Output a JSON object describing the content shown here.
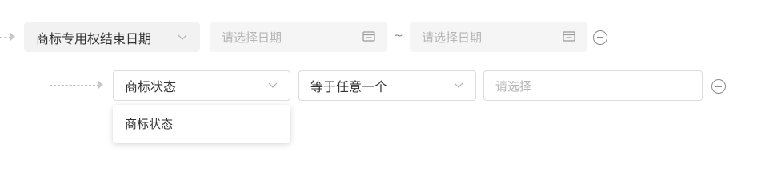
{
  "row1": {
    "field_select": {
      "value": "商标专用权结束日期"
    },
    "date_start": {
      "placeholder": "请选择日期"
    },
    "range_separator": "~",
    "date_end": {
      "placeholder": "请选择日期"
    }
  },
  "row2": {
    "field_select": {
      "value": "商标状态"
    },
    "operator_select": {
      "value": "等于任意一个"
    },
    "value_input": {
      "placeholder": "请选择"
    }
  },
  "dropdown": {
    "options": [
      "商标状态"
    ]
  }
}
